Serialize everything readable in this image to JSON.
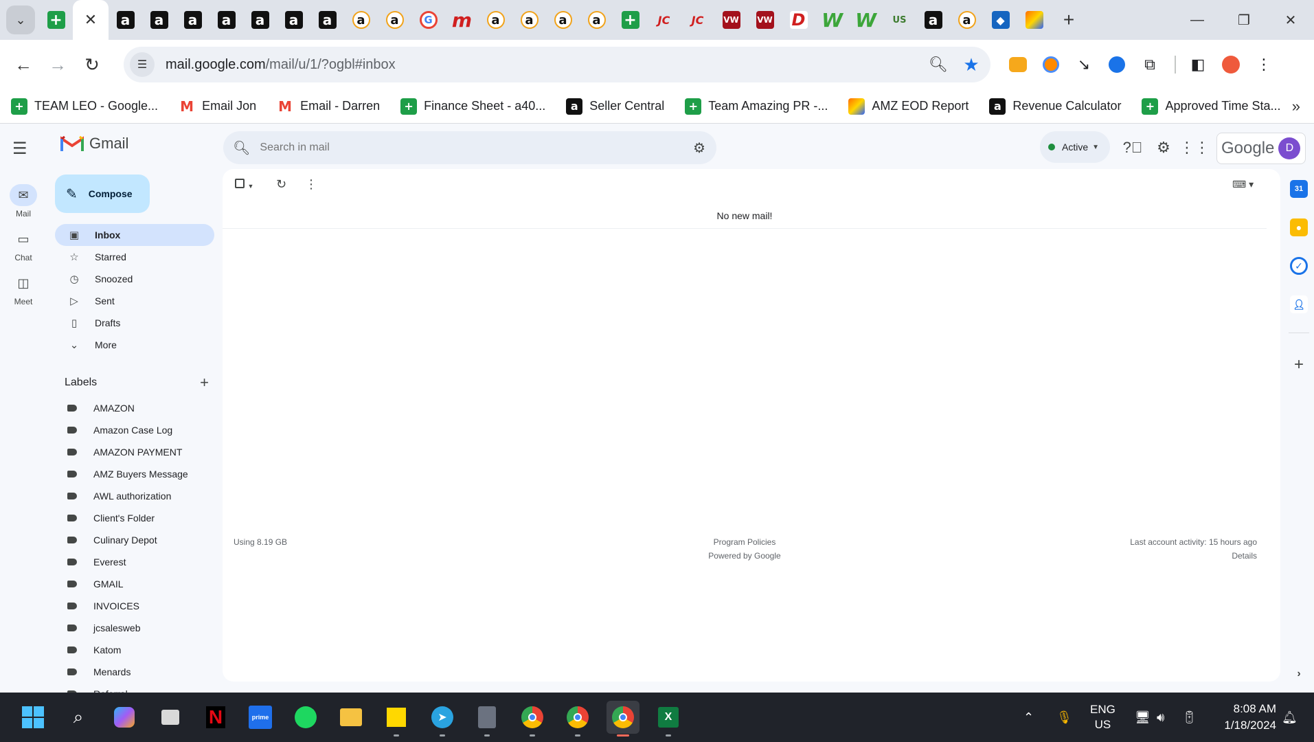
{
  "browser": {
    "tab_icons": [
      "sheets",
      "amz",
      "amz",
      "amz",
      "amz",
      "amz",
      "amz",
      "amz",
      "amzw",
      "amzw",
      "goog",
      "m",
      "amzw",
      "amzw",
      "amzw",
      "amzw",
      "sheets",
      "jc",
      "jc",
      "vw",
      "vw",
      "d",
      "w",
      "w",
      "us",
      "amz",
      "amzw",
      "diam",
      "pen"
    ],
    "tab_glyphs": {
      "sheets": "+",
      "amz": "a",
      "amzw": "a",
      "goog": "G",
      "m": "m",
      "jc": "JC",
      "vw": "VW",
      "d": "D",
      "w": "W",
      "us": "US",
      "diam": "◆",
      "pen": ""
    },
    "url_host": "mail.google.com",
    "url_path": "/mail/u/1/?ogbl#inbox",
    "bookmarks": [
      {
        "icon": "sheets",
        "label": "TEAM LEO - Google..."
      },
      {
        "icon": "gmail",
        "label": "Email Jon"
      },
      {
        "icon": "gmail",
        "label": "Email - Darren"
      },
      {
        "icon": "sheets",
        "label": "Finance Sheet - a40..."
      },
      {
        "icon": "amz",
        "label": "Seller Central"
      },
      {
        "icon": "sheets",
        "label": "Team Amazing PR -..."
      },
      {
        "icon": "pen",
        "label": "AMZ EOD Report"
      },
      {
        "icon": "amz",
        "label": "Revenue Calculator"
      },
      {
        "icon": "sheets",
        "label": "Approved Time Sta..."
      }
    ]
  },
  "gmail": {
    "app_name": "Gmail",
    "rail": [
      {
        "name": "mail",
        "label": "Mail",
        "icon": "✉"
      },
      {
        "name": "chat",
        "label": "Chat",
        "icon": "▭"
      },
      {
        "name": "meet",
        "label": "Meet",
        "icon": "◫"
      }
    ],
    "compose_label": "Compose",
    "nav": [
      {
        "key": "inbox",
        "label": "Inbox",
        "icon": "▣",
        "selected": true
      },
      {
        "key": "starred",
        "label": "Starred",
        "icon": "☆",
        "selected": false
      },
      {
        "key": "snoozed",
        "label": "Snoozed",
        "icon": "◷",
        "selected": false
      },
      {
        "key": "sent",
        "label": "Sent",
        "icon": "▷",
        "selected": false
      },
      {
        "key": "drafts",
        "label": "Drafts",
        "icon": "▯",
        "selected": false
      },
      {
        "key": "more",
        "label": "More",
        "icon": "⌄",
        "selected": false
      }
    ],
    "labels_title": "Labels",
    "labels": [
      "AMAZON",
      "Amazon Case Log",
      "AMAZON PAYMENT",
      "AMZ Buyers Message",
      "AWL authorization",
      "Client's Folder",
      "Culinary Depot",
      "Everest",
      "GMAIL",
      "INVOICES",
      "jcsalesweb",
      "Katom",
      "Menards",
      "Referral"
    ],
    "search_placeholder": "Search in mail",
    "status_label": "Active",
    "account_brand": "Google",
    "account_initial": "D",
    "empty_message": "No new mail!",
    "storage": "Using 8.19 GB",
    "program_policies": "Program Policies",
    "powered_by": "Powered by Google",
    "last_activity": "Last account activity: 15 hours ago",
    "details": "Details"
  },
  "taskbar": {
    "apps": [
      "start",
      "search",
      "copilot",
      "taskview",
      "netflix",
      "primevideo",
      "spotify",
      "explorer",
      "stickynotes",
      "telegram",
      "calculator",
      "chrome",
      "chrome",
      "chrome",
      "excel"
    ],
    "language": "ENG",
    "region": "US",
    "time": "8:08 AM",
    "date": "1/18/2024"
  },
  "colors": {
    "accent": "#1a73e8",
    "compose_bg": "#c2e7ff",
    "selected_bg": "#d3e3fd"
  }
}
